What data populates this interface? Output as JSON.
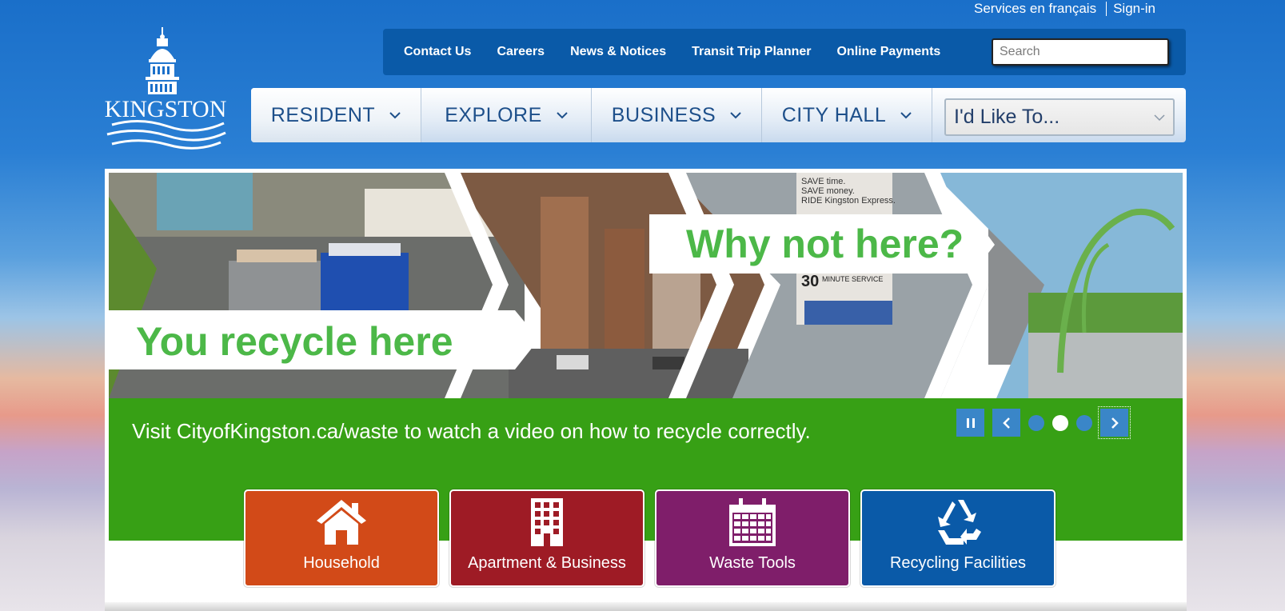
{
  "toplinks": {
    "french": "Services en français",
    "signin": "Sign-in"
  },
  "logo": {
    "text": "KINGSTON"
  },
  "utility_nav": {
    "items": [
      "Contact Us",
      "Careers",
      "News & Notices",
      "Transit Trip Planner",
      "Online Payments"
    ],
    "search_placeholder": "Search"
  },
  "main_nav": {
    "tabs": [
      "RESIDENT",
      "EXPLORE",
      "BUSINESS",
      "CITY HALL"
    ],
    "like_to": "I'd Like To..."
  },
  "hero": {
    "headline_left": "You recycle here",
    "headline_right": "Why not here?",
    "caption": "Visit CityofKingston.ca/waste to watch a video on how to recycle correctly.",
    "bus_sign_1": "SAVE time.",
    "bus_sign_2": "SAVE money.",
    "bus_sign_3": "RIDE Kingston Express.",
    "bus_sign_4": "30",
    "bus_sign_5": "MINUTE SERVICE",
    "slides_total": 3,
    "active_slide": 2
  },
  "tiles": [
    {
      "label": "Household",
      "icon": "house-icon",
      "color": "#d24a18"
    },
    {
      "label": "Apartment & Business",
      "icon": "building-icon",
      "color": "#9e1b25"
    },
    {
      "label": "Waste Tools",
      "icon": "calendar-icon",
      "color": "#7f1e6a"
    },
    {
      "label": "Recycling Facilities",
      "icon": "recycle-icon",
      "color": "#0a5aa8"
    }
  ],
  "colors": {
    "brand_blue": "#0a5aa8",
    "hero_green": "#37a015",
    "headline_green": "#4cb848"
  }
}
